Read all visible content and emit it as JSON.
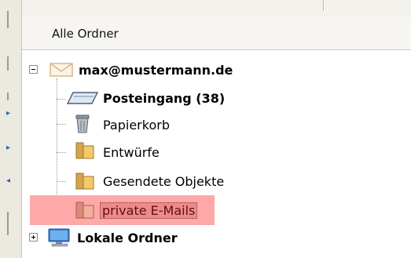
{
  "header": {
    "title": "Alle Ordner"
  },
  "tree": {
    "account": {
      "label": "max@mustermann.de",
      "icon": "envelope-icon",
      "expanded": true
    },
    "folders": [
      {
        "label": "Posteingang (38)",
        "icon": "inbox-tray-icon",
        "bold": true
      },
      {
        "label": "Papierkorb",
        "icon": "trash-icon",
        "bold": false
      },
      {
        "label": "Entwürfe",
        "icon": "folder-icon",
        "bold": false
      },
      {
        "label": "Gesendete Objekte",
        "icon": "folder-icon",
        "bold": false
      },
      {
        "label": "private E-Mails",
        "icon": "folder-icon",
        "bold": false,
        "selected": true
      }
    ],
    "local": {
      "label": "Lokale Ordner",
      "icon": "computer-icon",
      "expanded": false
    }
  },
  "colors": {
    "selection_highlight": "#ffa8a8",
    "selected_label_bg": "#f08a8a",
    "folder_yellow": "#f5c96a",
    "strip_blue": "#2e63b8"
  }
}
